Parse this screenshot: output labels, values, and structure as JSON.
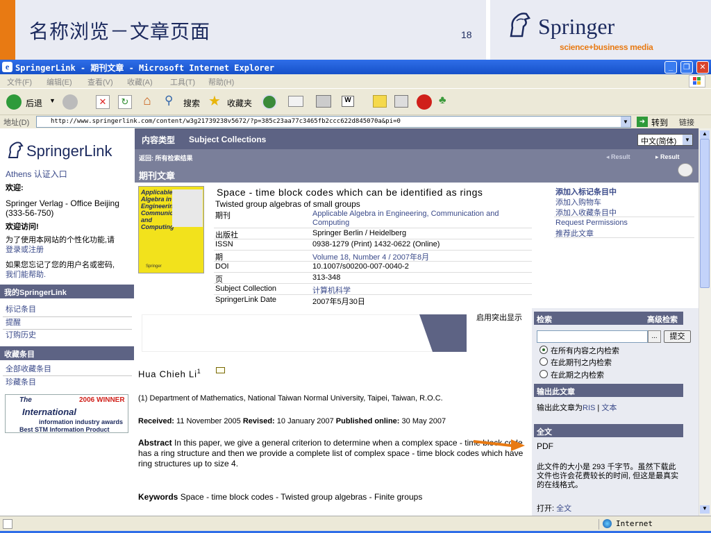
{
  "slide": {
    "title": "名称浏览－文章页面",
    "page_number": "18",
    "logo_name": "Springer",
    "logo_tagline": "science+business media"
  },
  "window": {
    "title": "SpringerLink - 期刊文章 - Microsoft Internet Explorer",
    "icon_glyph": "e"
  },
  "menu": [
    "文件(F)",
    "编辑(E)",
    "查看(V)",
    "收藏(A)",
    "工具(T)",
    "帮助(H)"
  ],
  "toolbar": {
    "back": "后退",
    "search": "搜索",
    "favorites": "收藏夹"
  },
  "address": {
    "label": "地址(D)",
    "url": "http://www.springerlink.com/content/w3g21739238v5672/?p=385c23aa77c3465fb2ccc622d845070a&pi=0",
    "go": "转到",
    "links": "链接"
  },
  "left": {
    "logo": "SpringerLink",
    "athens": "Athens 认证入口",
    "welcome": "欢迎:",
    "org": "Springer Verlag - Office Beijing (333-56-750)",
    "visit": "欢迎访问!",
    "personal_prompt": "为了使用本网站的个性化功能,请",
    "login": "登录或注册",
    "forgot": "如果您忘记了您的用户名或密码,",
    "help": "我们能帮助.",
    "my_section": "我的SpringerLink",
    "my_items": [
      "标记条目",
      "提醒",
      "订购历史"
    ],
    "fav_section": "收藏条目",
    "fav_items": [
      "全部收藏条目",
      "珍藏条目"
    ],
    "award": {
      "the": "The",
      "year": "2006 WINNER",
      "name": "International",
      "line1": "information industry awards",
      "line2": "Best STM Information Product"
    }
  },
  "nav": {
    "content_type": "内容类型",
    "subject_collections": "Subject Collections",
    "back": "返回: 所有检索结果",
    "result_prev": "Result",
    "result_next": "Result",
    "section_title": "期刊文章",
    "language": "中文(简体)"
  },
  "article": {
    "title": "Space - time  block  codes  which  can  be identified as rings",
    "subtitle": "Twisted group algebras of small groups",
    "meta": [
      {
        "key": "期刊",
        "value": "Applicable Algebra in Engineering, Communication and Computing",
        "link": true
      },
      {
        "key": "出版社",
        "value": "Springer Berlin / Heidelberg",
        "link": false
      },
      {
        "key": "ISSN",
        "value": "0938-1279 (Print) 1432-0622 (Online)",
        "link": false
      },
      {
        "key": "期",
        "value": "Volume 18, Number 4 / 2007年8月",
        "link": true
      },
      {
        "key": "DOI",
        "value": "10.1007/s00200-007-0040-2",
        "link": false
      },
      {
        "key": "页",
        "value": "313-348",
        "link": false
      },
      {
        "key": "Subject Collection",
        "value": "计算机科学",
        "link": true
      },
      {
        "key": "SpringerLink Date",
        "value": "2007年5月30日",
        "link": false
      }
    ],
    "actions": [
      "添加入标记条目中",
      "添加入购物车",
      "添加入收藏条目中",
      "Request Permissions",
      "推荐此文章"
    ],
    "cover": {
      "title": "Applicable Algebra in Engineering, Communication and Computing",
      "label": "Springer"
    }
  },
  "body": {
    "highlight_toggle": "启用突出显示",
    "author": "Hua Chieh Li",
    "author_sup": "1",
    "affiliation": "(1)  Department of Mathematics, National Taiwan Normal University, Taipei, Taiwan, R.O.C.",
    "received_label": "Received:",
    "received": "11 November 2005",
    "revised_label": "Revised:",
    "revised": "10 January 2007",
    "published_label": "Published online:",
    "published": "30 May 2007",
    "abstract_label": "Abstract",
    "abstract": "In this paper, we give a general criterion to determine when a complex space - time block code has a ring structure and then we provide a complete list of complex space - time block codes which have ring structures up to size 4.",
    "keywords_label": "Keywords",
    "keywords": "Space - time  block  codes  - Twisted group algebras - Finite groups"
  },
  "right": {
    "search": "检索",
    "advanced": "高级检索",
    "ellipsis": "...",
    "submit": "提交",
    "radios": [
      "在所有内容之内检索",
      "在此期刊之内检索",
      "在此期之内检索"
    ],
    "export_title": "输出此文章",
    "export_text": "输出此文章为",
    "ris": "RIS",
    "sep": "|",
    "text_link": "文本",
    "fulltext_title": "全文",
    "pdf": "PDF",
    "size_note": "此文件的大小是 293 千字节。虽然下载此文件也许会花费较长的时间, 但这是最真实的在线格式。",
    "open_label": "打开:",
    "open_link": "全文"
  },
  "status": {
    "zone": "Internet"
  },
  "colors": {
    "accent": "#e87a13",
    "navy": "#1c2a5e",
    "band": "#5d6384",
    "link": "#3a4a8a"
  }
}
